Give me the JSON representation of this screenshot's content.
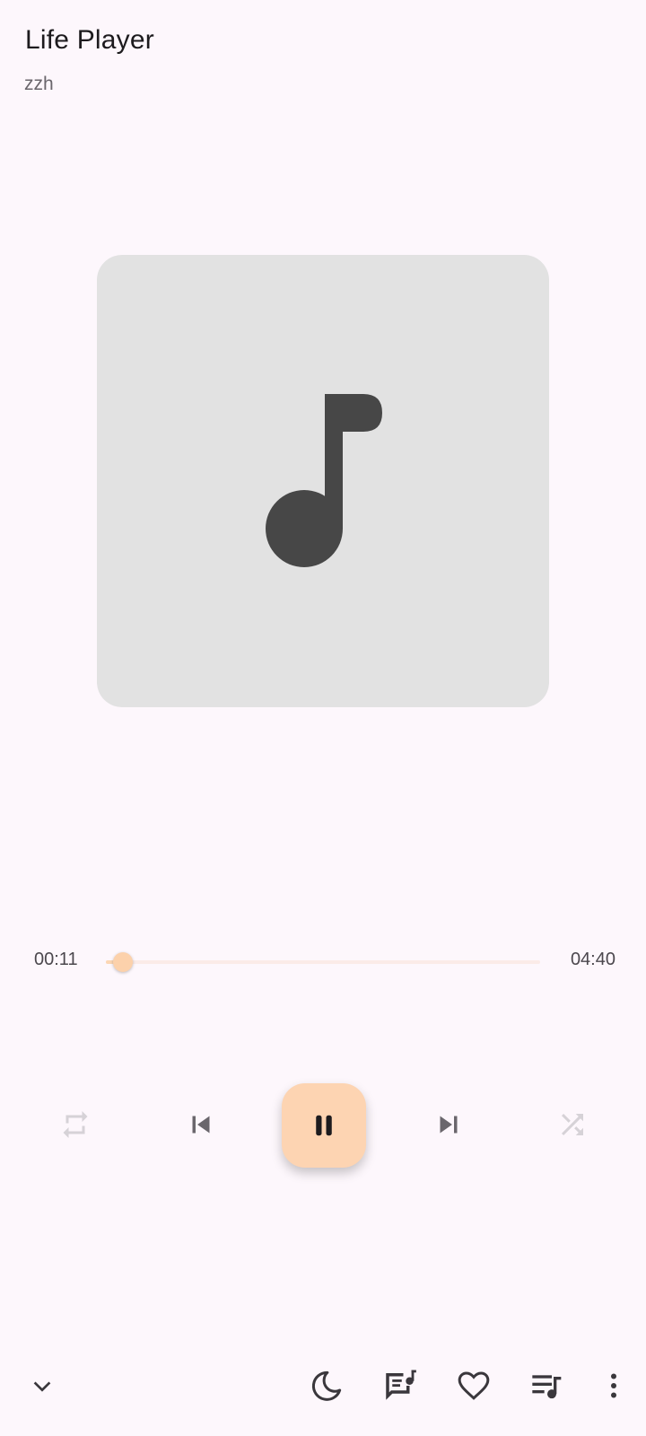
{
  "header": {
    "title": "Life Player",
    "artist": "zzh"
  },
  "cover": {
    "icon": "music-note-icon",
    "background": "#e2e2e2",
    "icon_color": "#474747"
  },
  "progress": {
    "elapsed": "00:11",
    "total": "04:40",
    "fraction": 0.04,
    "accent": "#fcd1ab"
  },
  "controls": {
    "repeat": {
      "icon": "repeat-icon",
      "enabled": false
    },
    "previous": {
      "icon": "skip-previous-icon"
    },
    "play_pause": {
      "icon": "pause-icon",
      "state": "playing"
    },
    "next": {
      "icon": "skip-next-icon"
    },
    "shuffle": {
      "icon": "shuffle-icon",
      "enabled": false
    }
  },
  "bottom_bar": [
    {
      "icon": "chevron-down-icon"
    },
    {
      "icon": "moon-icon"
    },
    {
      "icon": "lyrics-icon"
    },
    {
      "icon": "heart-icon"
    },
    {
      "icon": "queue-music-icon"
    },
    {
      "icon": "more-vert-icon"
    }
  ]
}
